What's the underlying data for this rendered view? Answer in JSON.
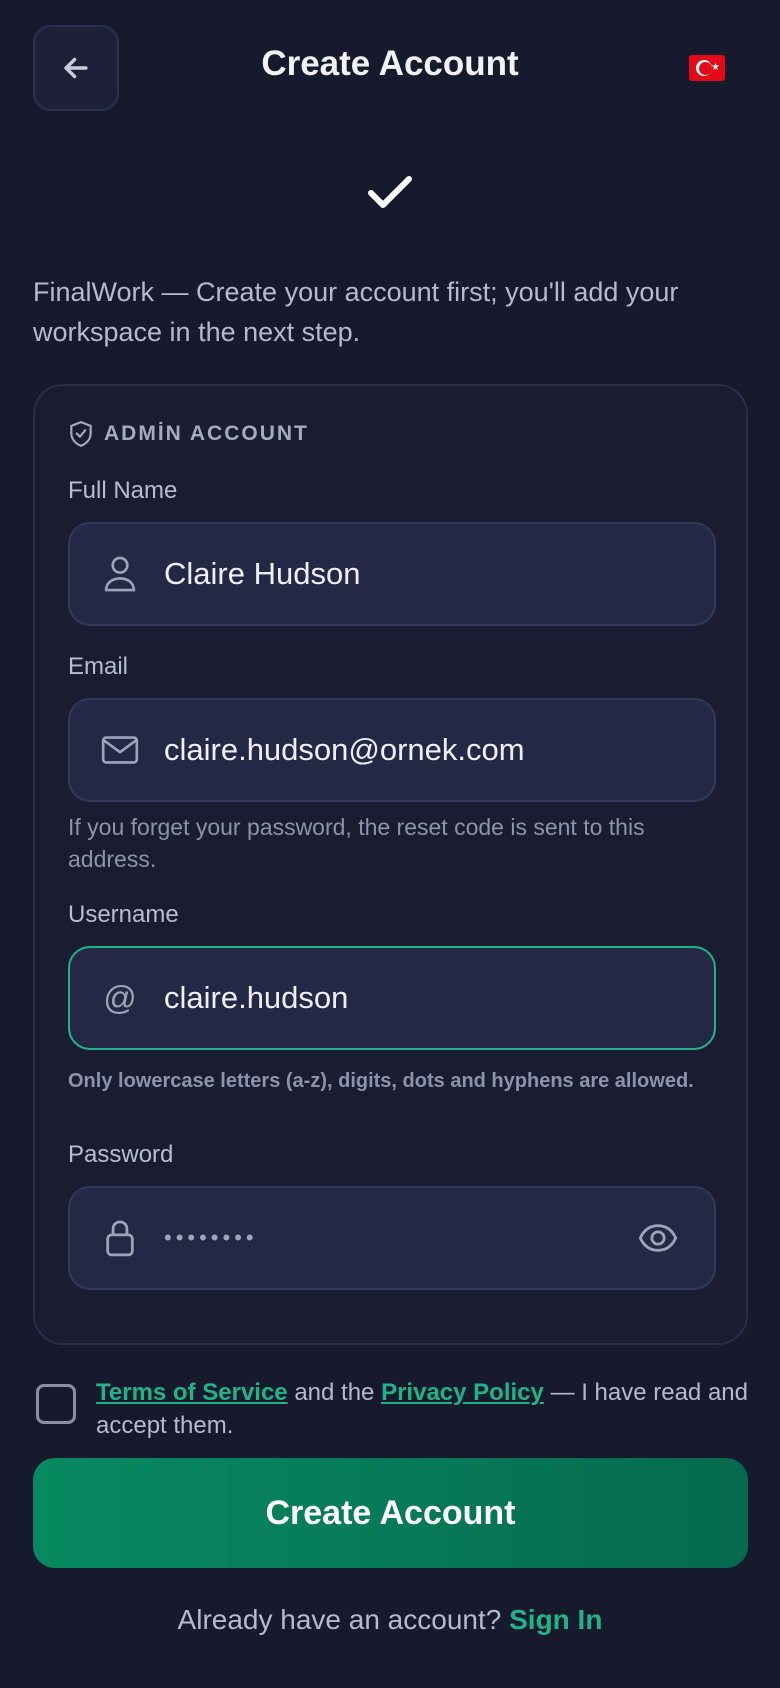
{
  "header": {
    "title": "Create Account",
    "back_icon": "arrow-left-icon",
    "flag_icon": "turkey-flag-icon"
  },
  "intro_text": "FinalWork — Create your account first; you'll add your workspace in the next step.",
  "form": {
    "section_title": "ADMİN ACCOUNT",
    "full_name": {
      "label": "Full Name",
      "value": "Claire Hudson",
      "icon": "user-icon"
    },
    "email": {
      "label": "Email",
      "value": "claire.hudson@ornek.com",
      "icon": "mail-icon",
      "hint": "If you forget your password, the reset code is sent to this address."
    },
    "username": {
      "label": "Username",
      "prefix": "@",
      "value": "claire.hudson",
      "hint": "Only lowercase letters (a-z), digits, dots and hyphens are allowed."
    },
    "password": {
      "label": "Password",
      "value": "••••••••",
      "icon": "lock-icon"
    }
  },
  "terms": {
    "checked": false,
    "tos_link": "Terms of Service",
    "middle": "and the",
    "privacy_link": "Privacy Policy",
    "suffix": "— I have read and accept them."
  },
  "submit_label": "Create Account",
  "footer": {
    "prompt": "Already have an account?",
    "link": "Sign In"
  },
  "colors": {
    "background": "#171a2c",
    "accent": "#1fb487",
    "button": "#078a61"
  }
}
